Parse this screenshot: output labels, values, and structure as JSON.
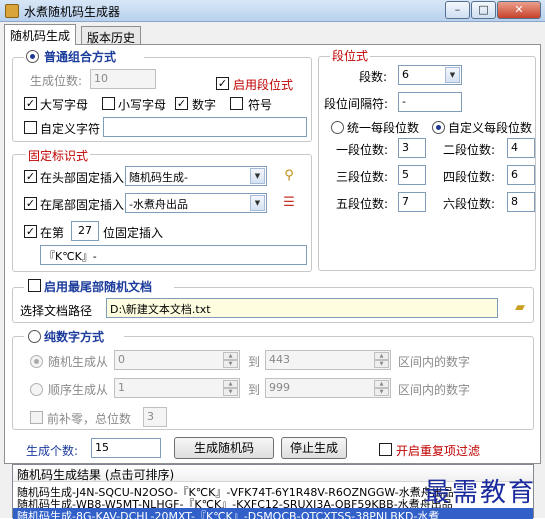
{
  "window": {
    "title": "水煮随机码生成器"
  },
  "tabs": [
    "随机码生成",
    "版本历史"
  ],
  "combo_mode": {
    "label": "普通组合方式",
    "gen_bits_label": "生成位数:",
    "gen_bits_value": "10",
    "enable_segment_label": "启用段位式",
    "uppercase_label": "大写字母",
    "lowercase_label": "小写字母",
    "digits_label": "数字",
    "symbols_label": "符号",
    "custom_chars_label": "自定义字符",
    "custom_chars_value": ""
  },
  "fixed_marks": {
    "group_label": "固定标识式",
    "head_label": "在头部固定插入",
    "head_value": "随机码生成-",
    "tail_label": "在尾部固定插入",
    "tail_value": "-水煮舟出品",
    "pos_prefix": "在第",
    "pos_value": "27",
    "pos_suffix": "位固定插入",
    "pos_text": "『K℃K』-"
  },
  "segment": {
    "group_label": "段位式",
    "count_label": "段数:",
    "count_value": "6",
    "sep_label": "段位间隔符:",
    "sep_value": "-",
    "uniform_label": "统一每段位数",
    "custom_label": "自定义每段位数",
    "rows": [
      {
        "l1": "一段位数:",
        "v1": "3",
        "l2": "二段位数:",
        "v2": "4"
      },
      {
        "l1": "三段位数:",
        "v1": "5",
        "l2": "四段位数:",
        "v2": "6"
      },
      {
        "l1": "五段位数:",
        "v1": "7",
        "l2": "六段位数:",
        "v2": "8"
      }
    ]
  },
  "doc": {
    "enable_label": "启用最尾部随机文档",
    "path_label": "选择文档路径",
    "path_value": "D:\\新建文本文档.txt"
  },
  "numeric": {
    "label": "纯数字方式",
    "random_label": "随机生成从",
    "random_from": "0",
    "to_label": "到",
    "random_to": "443",
    "range_label": "区间内的数字",
    "seq_label": "顺序生成从",
    "seq_from": "1",
    "seq_to": "999",
    "zero_pad_label": "前补零，总位数",
    "zero_pad_value": "3"
  },
  "bottom": {
    "count_label": "生成个数:",
    "count_value": "15",
    "gen_button": "生成随机码",
    "stop_button": "停止生成",
    "dedupe_label": "开启重复项过滤"
  },
  "results": {
    "header": "随机码生成结果 (点击可排序)",
    "rows": [
      "随机码生成-J4N-SQCU-N2OSO-『K℃K』-VFK74T-6Y1R48V-R6OZNGGW-水煮舟出品",
      "随机码生成-WB8-W5MT-NLHGF-『K℃K』-KXFC12-SRUXI3A-OBF59KBB-水煮舟出品",
      "随机码生成-8G-KAV-DCHL-20MXT-『K℃K』-DSMOCB-OTCXTSS-38PNLBKD-水煮"
    ]
  },
  "watermark": "最需教育"
}
